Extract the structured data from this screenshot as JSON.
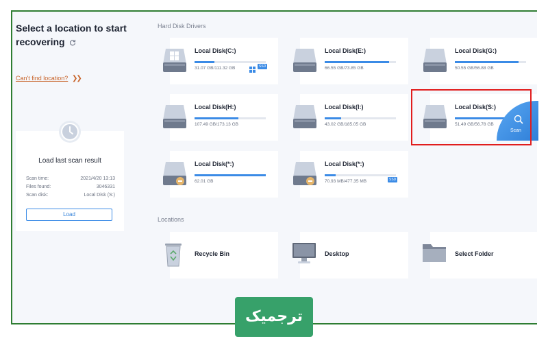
{
  "sidebar": {
    "title": "Select a location to start recovering",
    "cant_find": "Can't find location?",
    "scan_card": {
      "title": "Load last scan result",
      "scan_time_label": "Scan time:",
      "scan_time_value": "2021/4/20 13:13",
      "files_found_label": "Files found:",
      "files_found_value": "3046331",
      "scan_disk_label": "Scan disk:",
      "scan_disk_value": "Local Disk (S:)",
      "load_button": "Load"
    }
  },
  "main": {
    "hard_disk_section": "Hard Disk Drivers",
    "locations_section": "Locations",
    "disks": [
      {
        "name": "Local Disk(C:)",
        "size": "31.07 GB/111.32 GB",
        "used_fraction": 0.28,
        "badge": "SSD",
        "windows": true
      },
      {
        "name": "Local Disk(E:)",
        "size": "66.55 GB/73.85 GB",
        "used_fraction": 0.9
      },
      {
        "name": "Local Disk(G:)",
        "size": "50.55 GB/56.88 GB",
        "used_fraction": 0.89
      },
      {
        "name": "Local Disk(H:)",
        "size": "107.49 GB/173.13 GB",
        "used_fraction": 0.62
      },
      {
        "name": "Local Disk(I:)",
        "size": "43.02 GB/185.05 GB",
        "used_fraction": 0.23
      },
      {
        "name": "Local Disk(S:)",
        "size": "51.49 GB/56.78 GB",
        "used_fraction": 0.9,
        "scan_label": "Scan"
      },
      {
        "name": "Local Disk(*:)",
        "size": "62.01 GB",
        "used_fraction": 1.0
      },
      {
        "name": "Local Disk(*:)",
        "size": "70.93 MB/477.35 MB",
        "used_fraction": 0.15,
        "badge": "SSD"
      }
    ],
    "locations": [
      {
        "name": "Recycle Bin",
        "icon": "recycle-bin-icon"
      },
      {
        "name": "Desktop",
        "icon": "monitor-icon"
      },
      {
        "name": "Select Folder",
        "icon": "folder-icon"
      }
    ]
  },
  "watermark": "ترجمیک",
  "colors": {
    "accent": "#3b8be6",
    "highlight": "#e11d1d",
    "frame": "#2e7d32",
    "link": "#c8642a",
    "brand": "#37a16a"
  }
}
